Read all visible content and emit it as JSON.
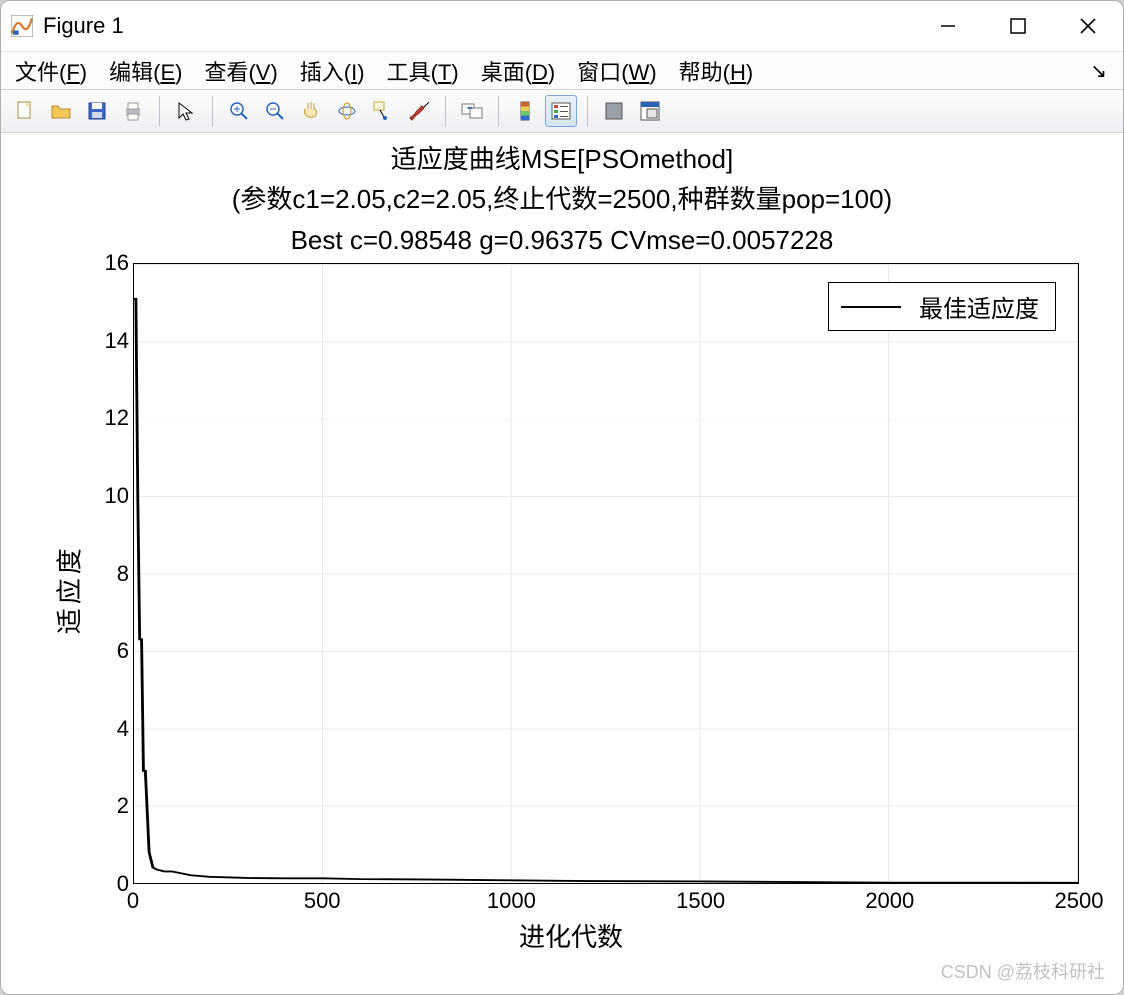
{
  "window": {
    "title": "Figure 1"
  },
  "menu": {
    "file": "文件(F)",
    "edit": "编辑(E)",
    "view": "查看(V)",
    "insert": "插入(I)",
    "tools": "工具(T)",
    "desktop": "桌面(D)",
    "window": "窗口(W)",
    "help": "帮助(H)"
  },
  "toolbar": {
    "new": "新建",
    "open": "打开",
    "save": "保存",
    "print": "打印",
    "pointer": "编辑绘图",
    "zoom_in": "放大",
    "zoom_out": "缩小",
    "pan": "平移",
    "rotate": "旋转",
    "datatip": "数据游标",
    "brush": "刷选",
    "link": "链接",
    "colorbar": "插入颜色栏",
    "legend": "插入图例",
    "hide": "隐藏绘图工具",
    "dock": "停靠"
  },
  "chart_data": {
    "type": "line",
    "title_line1": "适应度曲线MSE[PSOmethod]",
    "title_line2": "(参数c1=2.05,c2=2.05,终止代数=2500,种群数量pop=100)",
    "title_line3": "Best c=0.98548 g=0.96375 CVmse=0.0057228",
    "xlabel": "进化代数",
    "ylabel": "适应度",
    "xlim": [
      0,
      2500
    ],
    "ylim": [
      0,
      16
    ],
    "xticks": [
      0,
      500,
      1000,
      1500,
      2000,
      2500
    ],
    "yticks": [
      0,
      2,
      4,
      6,
      8,
      10,
      12,
      14,
      16
    ],
    "legend": "最佳适应度",
    "series": [
      {
        "name": "最佳适应度",
        "x": [
          0,
          5,
          10,
          15,
          20,
          25,
          30,
          40,
          50,
          60,
          80,
          100,
          150,
          200,
          300,
          400,
          500,
          600,
          800,
          1000,
          1200,
          1500,
          2000,
          2500
        ],
        "values": [
          15.1,
          15.1,
          10.0,
          6.3,
          6.3,
          2.9,
          2.9,
          0.8,
          0.4,
          0.35,
          0.3,
          0.3,
          0.2,
          0.16,
          0.13,
          0.12,
          0.12,
          0.1,
          0.09,
          0.07,
          0.05,
          0.04,
          0.01,
          0.006
        ]
      }
    ]
  },
  "watermark": "CSDN @荔枝科研社"
}
